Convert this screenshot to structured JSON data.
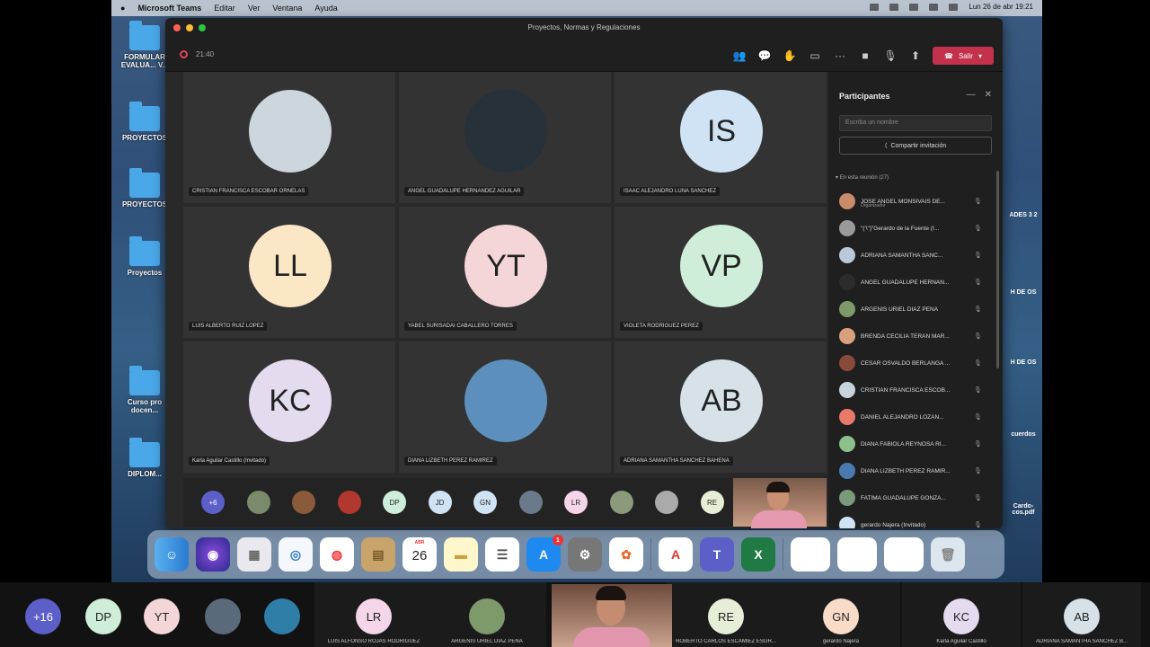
{
  "menubar": {
    "app": "Microsoft Teams",
    "items": [
      "Editar",
      "Ver",
      "Ventana",
      "Ayuda"
    ],
    "datetime": "Lun 26 de abr 19:21"
  },
  "desktop": {
    "icons": [
      {
        "label": "FORMULAR\nEVALUA... V..."
      },
      {
        "label": "PROYECTOS"
      },
      {
        "label": "PROYECTOS"
      },
      {
        "label": "Proyectos"
      },
      {
        "label": "Curso pro docen..."
      },
      {
        "label": "DIPLOM..."
      }
    ],
    "right": [
      "ADES 3 2",
      "H DE OS",
      "H DE OS",
      "cuerdos",
      "Cardo- cos.pdf"
    ]
  },
  "window": {
    "title": "Proyectos, Normas y Regulaciones",
    "timer": "21:40",
    "leave_label": "Salir"
  },
  "tiles": [
    {
      "name": "CRISTIAN FRANCISCA ESCOBAR ORNELAS",
      "initials": "",
      "color": "#ccd6dd",
      "photo": true
    },
    {
      "name": "ANGEL GUADALUPE HERNANDEZ AGUILAR",
      "initials": "",
      "color": "#27313a",
      "photo": true
    },
    {
      "name": "ISAAC ALEJANDRO LUNA SANCHEZ",
      "initials": "IS",
      "color": "#d0e3f5"
    },
    {
      "name": "LUIS ALBERTO RUIZ LOPEZ",
      "initials": "LL",
      "color": "#fbe7c6"
    },
    {
      "name": "YABEL SURISADAI CABALLERO TORRES",
      "initials": "YT",
      "color": "#f4d6d8"
    },
    {
      "name": "VIOLETA RODRIGUEZ PEREZ",
      "initials": "VP",
      "color": "#cfeed9"
    },
    {
      "name": "Karla Aguilar Castillo (Invitado)",
      "initials": "KC",
      "color": "#e4dbee"
    },
    {
      "name": "DIANA LIZBETH PEREZ RAMIREZ",
      "initials": "",
      "color": "#5d8fbd",
      "photo": true
    },
    {
      "name": "ADRIANA SAMANTHA SANCHEZ BAHENA",
      "initials": "AB",
      "color": "#d6e2e8"
    }
  ],
  "strip": [
    {
      "initials": "+6",
      "color": "#5b5fc7",
      "text": "#fff"
    },
    {
      "initials": "",
      "color": "#7a8a6a"
    },
    {
      "initials": "",
      "color": "#8a5a3a"
    },
    {
      "initials": "",
      "color": "#b0382f"
    },
    {
      "initials": "DP",
      "color": "#cfeed9"
    },
    {
      "initials": "JD",
      "color": "#d0e3f5"
    },
    {
      "initials": "GN",
      "color": "#d0e3f5"
    },
    {
      "initials": "",
      "color": "#6a7a8a"
    },
    {
      "initials": "LR",
      "color": "#f4d6e8"
    },
    {
      "initials": "",
      "color": "#8a9a7a"
    },
    {
      "initials": "",
      "color": "#aaaaaa"
    },
    {
      "initials": "RE",
      "color": "#e7eed8"
    }
  ],
  "panel": {
    "title": "Participantes",
    "search_placeholder": "Escriba un nombre",
    "share_label": "Compartir invitación",
    "section": "En esta reunión (27)",
    "rows": [
      {
        "name": "JOSE ANGEL MONSIVAIS DE...",
        "sub": "Organizador",
        "color": "#c98b6a"
      },
      {
        "name": "\"('\\\")\"Gerardo de la Fuente (I...",
        "color": "#9a9a9a"
      },
      {
        "name": "ADRIANA SAMANTHA SANC...",
        "color": "#b9c9d9"
      },
      {
        "name": "ANGEL GUADALUPE HERNAN...",
        "color": "#2c2c2c"
      },
      {
        "name": "ARGENIS URIEL DIAZ PENA",
        "color": "#7e9a6a"
      },
      {
        "name": "BRENDA CECILIA TERAN MAR...",
        "color": "#d9a07e"
      },
      {
        "name": "CESAR OSVALDO BERLANGA ...",
        "color": "#8a4a3a"
      },
      {
        "name": "CRISTIAN FRANCISCA ESCOB...",
        "color": "#c9d3db"
      },
      {
        "name": "DANIEL ALEJANDRO LOZAN...",
        "color": "#e97a6a"
      },
      {
        "name": "DIANA FABIOLA REYNOSA RI...",
        "color": "#8ac08a"
      },
      {
        "name": "DIANA LIZBETH PEREZ RAMIR...",
        "color": "#4a7ab0"
      },
      {
        "name": "FATIMA GUADALUPE GONZA...",
        "color": "#7a9a7a"
      },
      {
        "name": "gerardo Najera (Invitado)",
        "color": "#d0e3f5"
      }
    ]
  },
  "dock": {
    "calendar_month": "ABR",
    "calendar_day": "26",
    "badge": "1"
  },
  "bottom": [
    {
      "initials": "+16",
      "color": "#5b5fc7",
      "text": "#fff",
      "label": ""
    },
    {
      "initials": "DP",
      "color": "#cfeed9",
      "label": ""
    },
    {
      "initials": "YT",
      "color": "#f4d6d8",
      "label": ""
    },
    {
      "initials": "",
      "color": "#5a6a7a",
      "label": ""
    },
    {
      "initials": "",
      "color": "#2f7ea8",
      "label": ""
    },
    {
      "initials": "LR",
      "color": "#f4d6e8",
      "label": "LUIS ALFONSO ROJAS RODRIGUEZ"
    },
    {
      "initials": "",
      "color": "#7e9a6a",
      "label": "ARGENIS URIEL DIAZ PENA"
    },
    {
      "initials": "RE",
      "color": "#e7eed8",
      "label": "ROBERTO CARLOS ESCAMIEZ ESGR..."
    },
    {
      "initials": "GN",
      "color": "#f9dcc8",
      "label": "gerardo Najera"
    },
    {
      "initials": "KC",
      "color": "#e4dbee",
      "label": "Karla Aguilar Castillo"
    },
    {
      "initials": "AB",
      "color": "#d6e2e8",
      "label": "ADRIANA SAMANTHA SANCHEZ B..."
    }
  ]
}
